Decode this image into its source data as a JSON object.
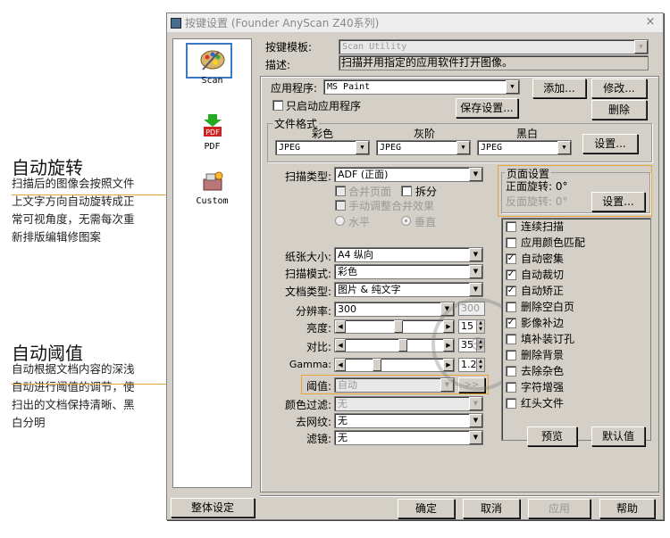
{
  "annotations": [
    {
      "title": "自动旋转",
      "lines": [
        "扫描后的图像会按照文件",
        "上文字方向自动旋转成正",
        "常可视角度，无需每次重",
        "新排版编辑修图案"
      ]
    },
    {
      "title": "自动阈值",
      "lines": [
        "自动根据文档内容的深浅",
        "自动进行阈值的调节，使",
        "扫出的文档保持清晰、黑",
        "白分明"
      ]
    }
  ],
  "window": {
    "title": "按键设置 (Founder AnyScan Z40系列)",
    "close": "×"
  },
  "sidebar": {
    "items": [
      {
        "label": "Scan"
      },
      {
        "label": "PDF",
        "icon_text": "PDF"
      },
      {
        "label": "Custom"
      }
    ],
    "global_settings": "整体设定"
  },
  "header": {
    "template_label": "按键模板:",
    "template_value": "Scan Utility",
    "desc_label": "描述:",
    "desc_value": "扫描并用指定的应用软件打开图像。"
  },
  "app": {
    "label": "应用程序:",
    "value": "MS Paint",
    "add": "添加...",
    "modify": "修改...",
    "delete": "删除",
    "only_launch": "只启动应用程序",
    "save_settings": "保存设置..."
  },
  "file_format": {
    "title": "文件格式",
    "color_label": "彩色",
    "gray_label": "灰阶",
    "bw_label": "黑白",
    "color_value": "JPEG",
    "gray_value": "JPEG",
    "bw_value": "JPEG",
    "settings": "设置..."
  },
  "scan_type": {
    "label": "扫描类型:",
    "value": "ADF (正面)",
    "merge_pages": "合并页面",
    "split": "拆分",
    "manual_merge": "手动调整合并效果",
    "horizontal": "水平",
    "vertical": "垂直"
  },
  "page_settings": {
    "title": "页面设置",
    "front_rotate": "正面旋转: 0°",
    "back_rotate": "反面旋转: 0°",
    "settings": "设置..."
  },
  "form": {
    "paper_size_label": "纸张大小:",
    "paper_size": "A4 纵向",
    "scan_mode_label": "扫描模式:",
    "scan_mode": "彩色",
    "doc_type_label": "文档类型:",
    "doc_type": "图片 & 纯文字",
    "resolution_label": "分辨率:",
    "resolution": "300",
    "resolution_side": "300",
    "brightness_label": "亮度:",
    "brightness": "15",
    "contrast_label": "对比:",
    "contrast": "35",
    "gamma_label": "Gamma:",
    "gamma": "1.20",
    "threshold_label": "阈值:",
    "threshold": "自动",
    "threshold_btn": ">>",
    "color_filter_label": "颜色过滤:",
    "color_filter": "无",
    "descreen_label": "去网纹:",
    "descreen": "无",
    "filter_label": "滤镜:",
    "filter": "无"
  },
  "options": [
    {
      "label": "连续扫描",
      "checked": false
    },
    {
      "label": "应用颜色匹配",
      "checked": false
    },
    {
      "label": "自动密集",
      "checked": true
    },
    {
      "label": "自动裁切",
      "checked": true
    },
    {
      "label": "自动矫正",
      "checked": true
    },
    {
      "label": "删除空白页",
      "checked": false
    },
    {
      "label": "影像补边",
      "checked": true
    },
    {
      "label": "填补装订孔",
      "checked": false
    },
    {
      "label": "删除背景",
      "checked": false
    },
    {
      "label": "去除杂色",
      "checked": false
    },
    {
      "label": "字符增强",
      "checked": false
    },
    {
      "label": "红头文件",
      "checked": false
    }
  ],
  "preview_btn": "预览",
  "default_btn": "默认值",
  "footer": {
    "ok": "确定",
    "cancel": "取消",
    "apply": "应用",
    "help": "帮助"
  },
  "slider_levels": {
    "brightness": 0.55,
    "contrast": 0.6,
    "gamma": 0.3
  },
  "colors": {
    "accent_annotation": "#e8a33a",
    "selection": "#3a78c8",
    "window_bg": "#d4d0c8"
  }
}
